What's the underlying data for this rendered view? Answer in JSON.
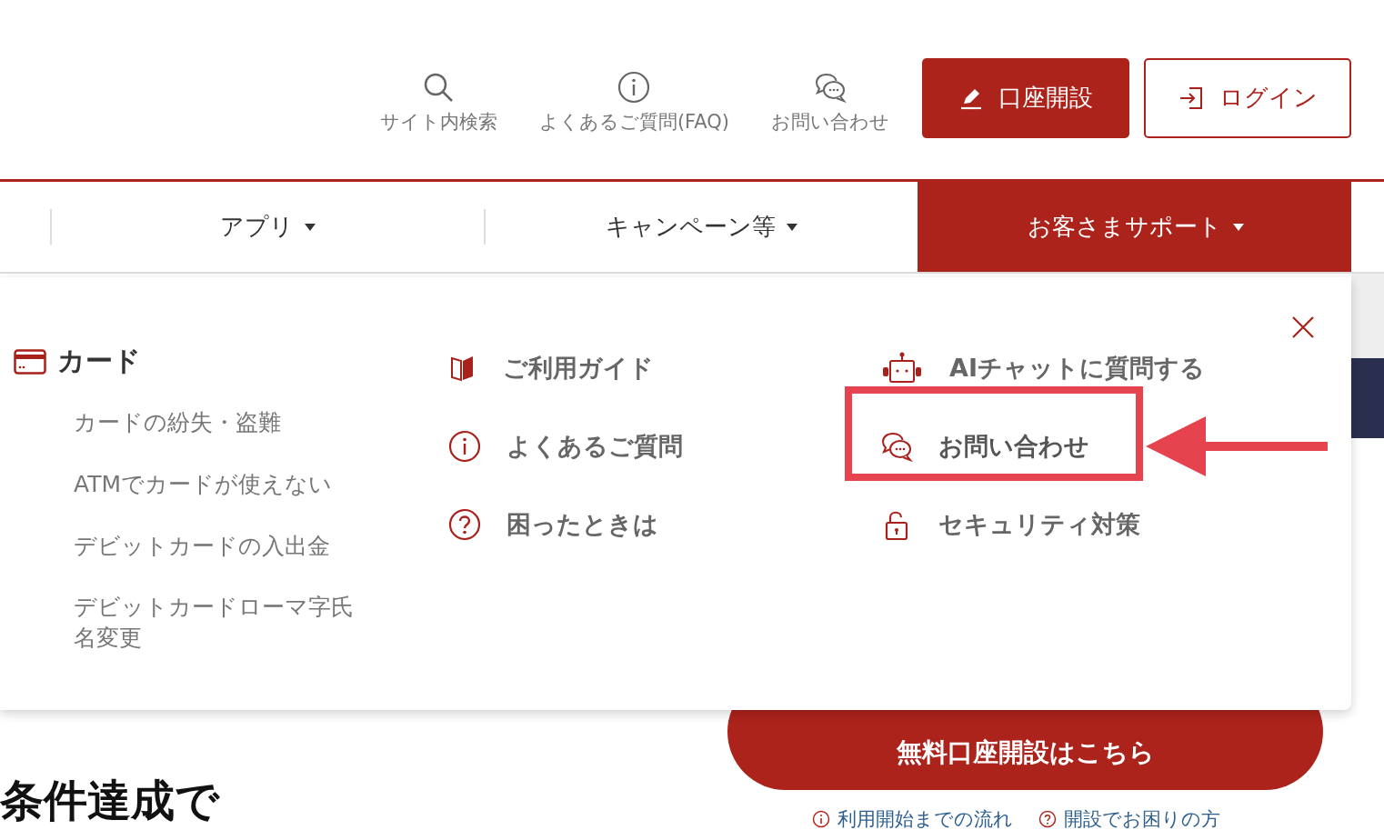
{
  "header": {
    "utility_links": [
      {
        "label": "サイト内検索"
      },
      {
        "label": "よくあるご質問(FAQ)"
      },
      {
        "label": "お問い合わせ"
      }
    ],
    "buttons": [
      {
        "label": "口座開設",
        "kind": "primary"
      },
      {
        "label": "ログイン",
        "kind": "outline"
      }
    ]
  },
  "nav": {
    "tabs": [
      {
        "label": "アプリ",
        "selected": false
      },
      {
        "label": "キャンペーン等",
        "selected": false
      },
      {
        "label": "お客さまサポート",
        "selected": true
      }
    ]
  },
  "dropdown": {
    "card_section": {
      "title": "カード",
      "links": [
        "カードの紛失・盗難",
        "ATMでカードが使えない",
        "デビットカードの入出金",
        "デビットカードローマ字氏名変更"
      ]
    },
    "guide_links": [
      {
        "label": "ご利用ガイド",
        "highlighted": false
      },
      {
        "label": "よくあるご質問",
        "highlighted": false
      },
      {
        "label": "困ったときは",
        "highlighted": false
      }
    ],
    "contact_links": [
      {
        "label": "AIチャットに質問する",
        "highlighted": false
      },
      {
        "label": "お問い合わせ",
        "highlighted": true
      },
      {
        "label": "セキュリティ対策",
        "highlighted": false
      }
    ]
  },
  "page": {
    "cta_button": "無料口座開設はこちら",
    "links": [
      "利用開始までの流れ",
      "開設でお困りの方"
    ],
    "heading": "条件達成で"
  }
}
